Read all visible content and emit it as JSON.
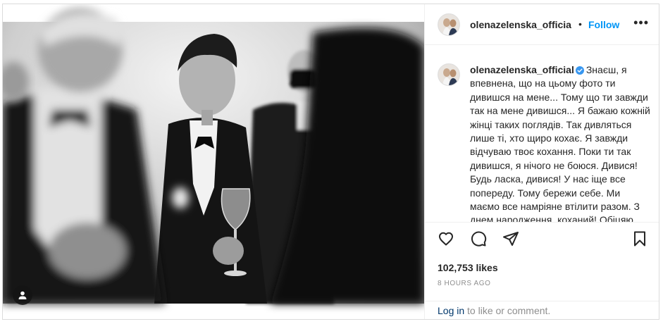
{
  "post": {
    "username": "olenazelenska_official",
    "header_username": "olenazelenska_officia",
    "dot": "•",
    "follow_label": "Follow",
    "more_label": "•••",
    "caption": "Знаєш, я впевнена, що на цьому фото ти дивишся на мене... Тому що ти завжди так на мене дивишся... Я бажаю кожній жінці таких поглядів. Так дивляться лише ті, хто щиро кохає. Я завжди відчуваю твоє кохання. Поки ти так дивишся, я нічого не боюся. Дивися! Будь ласка, дивися! У нас іще все попереду. Тому бережи себе. Ми маємо все намріяне втілити разом. З днем народження, коханий! Обіцяю",
    "likes": "102,753 likes",
    "time": "8 HOURS AGO",
    "login_link": "Log in",
    "login_rest": " to like or comment."
  },
  "icons": [
    "user-tag-icon",
    "heart-icon",
    "comment-icon",
    "share-icon",
    "bookmark-icon",
    "verified-badge-icon"
  ],
  "colors": {
    "accent": "#0095f6",
    "text": "#262626",
    "muted": "#8e8e8e",
    "border": "#dbdbdb",
    "verified": "#3897f0",
    "link": "#00376b"
  }
}
